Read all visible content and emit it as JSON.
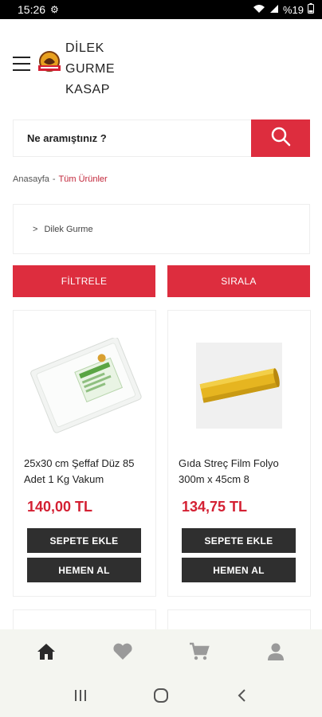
{
  "status": {
    "time": "15:26",
    "battery": "%19"
  },
  "brand": {
    "line1": "DİLEK",
    "line2": "GURME",
    "line3": "KASAP"
  },
  "search": {
    "placeholder": "Ne aramıştınız ?"
  },
  "breadcrumb": {
    "home": "Anasayfa",
    "sep": "-",
    "current": "Tüm Ürünler"
  },
  "category": {
    "arrow": ">",
    "label": "Dilek Gurme"
  },
  "actions": {
    "filter": "FİLTRELE",
    "sort": "SIRALA"
  },
  "products": [
    {
      "name": "25x30 cm Şeffaf Düz 85 Adet 1 Kg Vakum",
      "price": "140,00 TL",
      "add": "SEPETE EKLE",
      "buy": "HEMEN AL"
    },
    {
      "name": "Gıda Streç Film Folyo 300m x 45cm 8",
      "price": "134,75 TL",
      "add": "SEPETE EKLE",
      "buy": "HEMEN AL"
    }
  ],
  "nav": {
    "items": [
      "home-icon",
      "heart-icon",
      "cart-icon",
      "user-icon"
    ]
  },
  "colors": {
    "accent": "#dd2d3e",
    "price": "#d42033",
    "dark_button": "#2f2f2f"
  }
}
